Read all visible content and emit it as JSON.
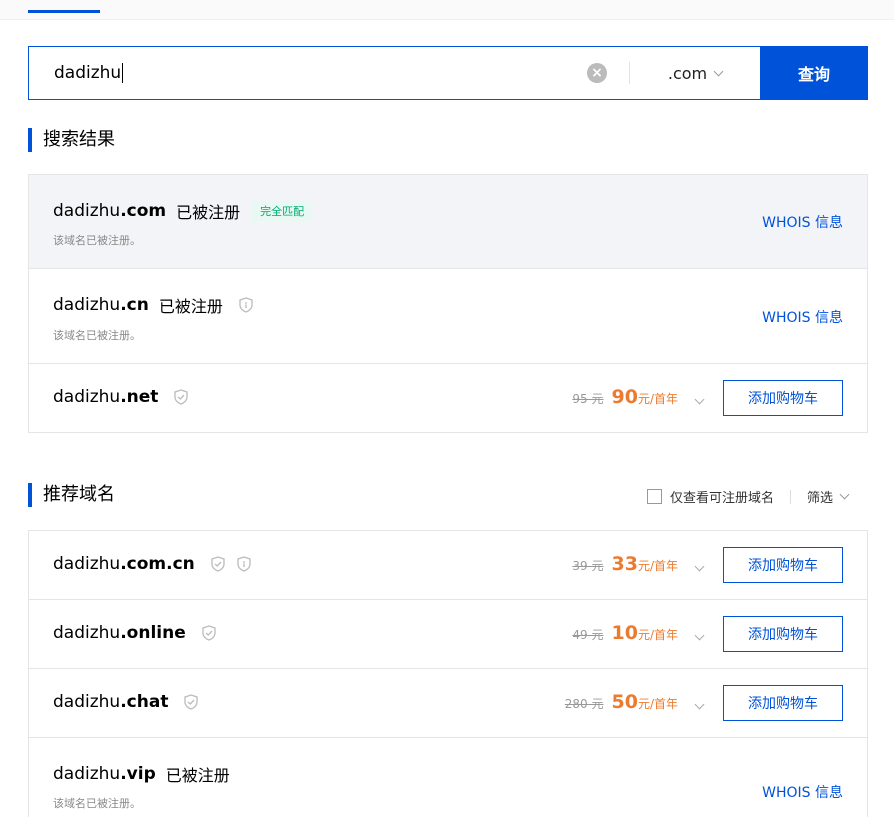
{
  "search": {
    "value": "dadizhu",
    "suffix": ".com",
    "button_label": "查询"
  },
  "results": {
    "title": "搜索结果",
    "items": [
      {
        "name": "dadizhu",
        "tld": ".com",
        "status": "已被注册",
        "tag": "完全匹配",
        "note": "该域名已被注册。",
        "whois": "WHOIS 信息"
      },
      {
        "name": "dadizhu",
        "tld": ".cn",
        "status": "已被注册",
        "note": "该域名已被注册。",
        "whois": "WHOIS 信息"
      },
      {
        "name": "dadizhu",
        "tld": ".net",
        "old_price": "95 元",
        "price": "90",
        "unit": "元/首年",
        "cart": "添加购物车"
      }
    ]
  },
  "recommend": {
    "title": "推荐域名",
    "filter_label": "仅查看可注册域名",
    "sort_label": "筛选",
    "items": [
      {
        "name": "dadizhu",
        "tld": ".com.cn",
        "old_price": "39 元",
        "price": "33",
        "unit": "元/首年",
        "cart": "添加购物车"
      },
      {
        "name": "dadizhu",
        "tld": ".online",
        "old_price": "49 元",
        "price": "10",
        "unit": "元/首年",
        "cart": "添加购物车"
      },
      {
        "name": "dadizhu",
        "tld": ".chat",
        "old_price": "280 元",
        "price": "50",
        "unit": "元/首年",
        "cart": "添加购物车"
      },
      {
        "name": "dadizhu",
        "tld": ".vip",
        "status": "已被注册",
        "note": "该域名已被注册。",
        "whois": "WHOIS 信息"
      }
    ]
  },
  "colors": {
    "accent": "#0052d9",
    "price": "#ed7b2f",
    "match_tag": "#00a870"
  }
}
